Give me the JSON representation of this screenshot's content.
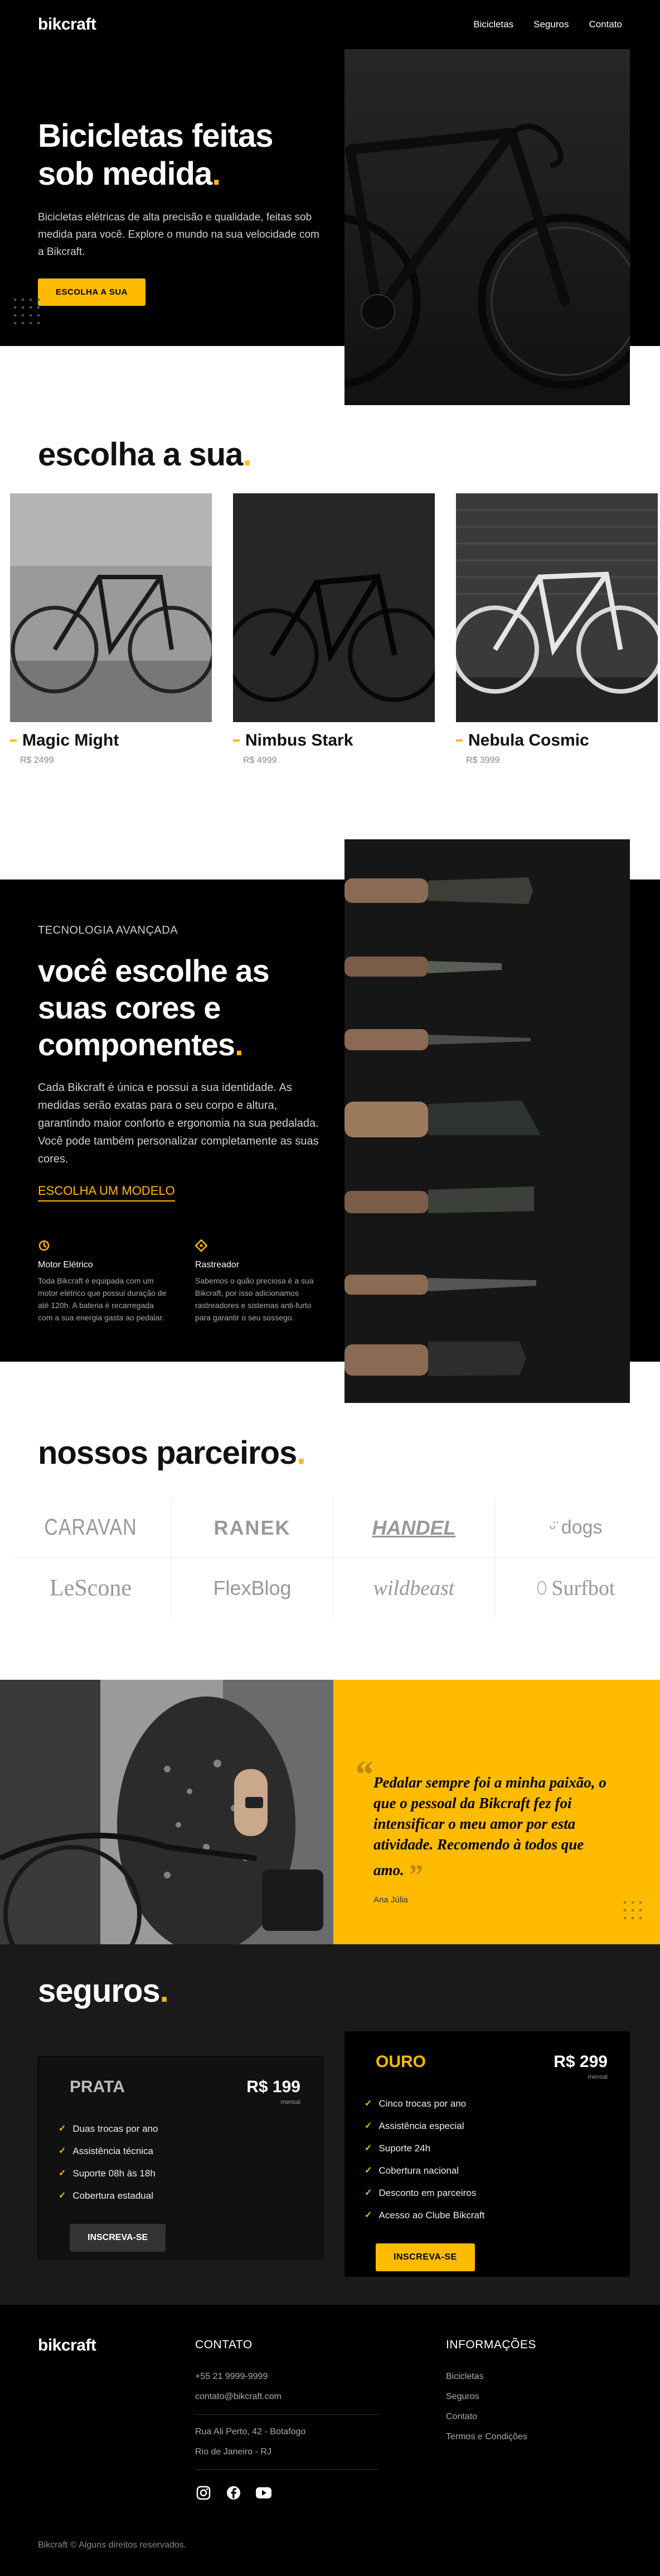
{
  "header": {
    "logo": "bikcraft",
    "nav": [
      "Bicicletas",
      "Seguros",
      "Contato"
    ]
  },
  "hero": {
    "title": "Bicicletas feitas sob medida",
    "text": "Bicicletas elétricas de alta precisão e qualidade, feitas sob medida para você. Explore o mundo na sua velocidade com a Bikcraft.",
    "button": "Escolha a sua"
  },
  "choose": {
    "title": "escolha a sua",
    "cards": [
      {
        "name": "Magic Might",
        "price": "R$ 2499"
      },
      {
        "name": "Nimbus Stark",
        "price": "R$ 4999"
      },
      {
        "name": "Nebula Cosmic",
        "price": "R$ 3999"
      }
    ]
  },
  "tech": {
    "kicker": "Tecnologia avançada",
    "title": "você escolhe as suas cores e componentes",
    "text": "Cada Bikcraft é única e possui a sua identidade. As medidas serão exatas para o seu corpo e altura, garantindo maior conforto e ergonomia na sua pedalada. Você pode também personalizar completamente as suas cores.",
    "link": "Escolha um modelo",
    "features": [
      {
        "title": "Motor Elétrico",
        "text": "Toda Bikcraft é equipada com um motor elétrico que possui duração de até 120h. A bateria é recarregada com a sua energia gasta ao pedalar."
      },
      {
        "title": "Rastreador",
        "text": "Sabemos o quão preciosa é a sua Bikcraft, por isso adicionamos rastreadores e sistemas anti-furto para garantir o seu sossego."
      }
    ]
  },
  "partners": {
    "title": "nossos parceiros",
    "logos": [
      "CARAVAN",
      "RANEK",
      "HANDEL",
      "dogs",
      "LeScone",
      "FlexBlog",
      "wildbeast",
      "Surfbot"
    ]
  },
  "testimonial": {
    "quote": "Pedalar sempre foi a minha paixão, o que o pessoal da Bikcraft fez foi intensificar o meu amor por esta atividade. Recomendo à todos que amo.",
    "author": "Ana Júlia"
  },
  "seguros": {
    "title": "seguros",
    "plans": [
      {
        "name": "PRATA",
        "price": "R$ 199",
        "period": "mensal",
        "items": [
          "Duas trocas por ano",
          "Assistência técnica",
          "Suporte 08h às 18h",
          "Cobertura estadual"
        ],
        "button": "Inscreva-se"
      },
      {
        "name": "OURO",
        "price": "R$ 299",
        "period": "mensal",
        "items": [
          "Cinco trocas por ano",
          "Assistência especial",
          "Suporte 24h",
          "Cobertura nacional",
          "Desconto em parceiros",
          "Acesso ao Clube Bikcraft"
        ],
        "button": "Inscreva-se"
      }
    ]
  },
  "footer": {
    "logo": "bikcraft",
    "contact_title": "Contato",
    "phone": "+55 21 9999-9999",
    "email": "contato@bikcraft.com",
    "address1": "Rua Ali Perto, 42 - Botafogo",
    "address2": "Rio de Janeiro - RJ",
    "info_title": "Informações",
    "info_links": [
      "Bicicletas",
      "Seguros",
      "Contato",
      "Termos e Condições"
    ],
    "copyright": "Bikcraft © Alguns direitos reservados."
  },
  "colors": {
    "accent": "#FFBB00",
    "dark": "#000000",
    "gray": "#1a1a1a"
  }
}
